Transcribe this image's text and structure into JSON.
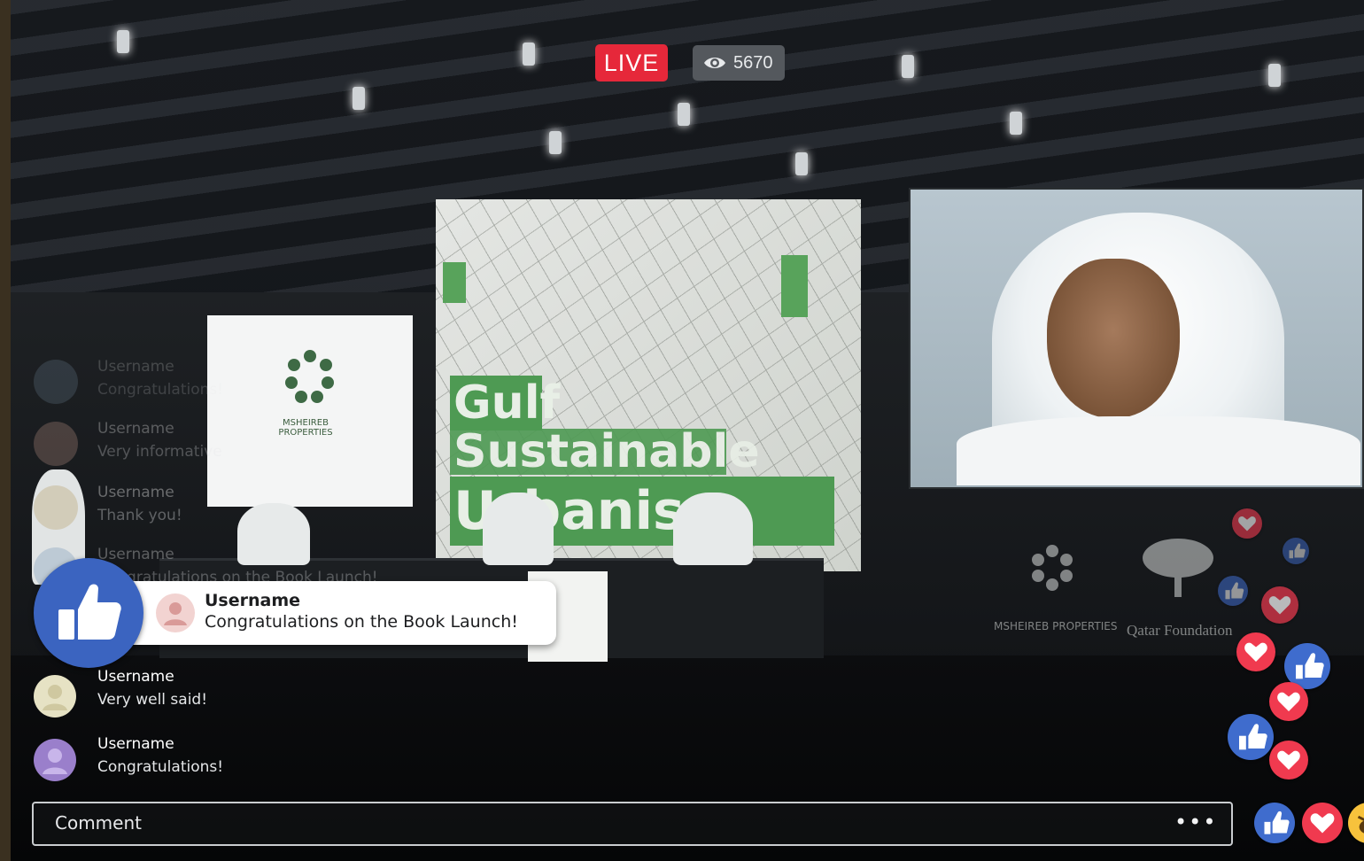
{
  "live_label": "LIVE",
  "viewer_count": "5670",
  "background_comments": [
    {
      "username": "Username",
      "text": "Congratulations!"
    },
    {
      "username": "Username",
      "text": "Very informative"
    },
    {
      "username": "Username",
      "text": "Thank you!"
    },
    {
      "username": "Username",
      "text": "Congratulations on the Book Launch!"
    }
  ],
  "highlighted_comment": {
    "username": "Username",
    "text": "Congratulations on the Book Launch!"
  },
  "recent_comments": [
    {
      "username": "Username",
      "text": "Very well said!",
      "avatar_color": "#e6e2c4"
    },
    {
      "username": "Username",
      "text": "Congratulations!",
      "avatar_color": "#9a7fcb"
    }
  ],
  "comment_input": {
    "placeholder": "Comment",
    "more_label": "•••"
  },
  "scene": {
    "banner_words": [
      "Gulf",
      "Sustainable",
      "Urbanism Book"
    ],
    "left_screen_logo_text": "MSHEIREB PROPERTIES",
    "wall_logo_text": [
      "MSHEIREB PROPERTIES",
      "Qatar Foundation"
    ]
  },
  "colors": {
    "live": "#e6283a",
    "like": "#3f6ccd",
    "love": "#f03a4f"
  }
}
